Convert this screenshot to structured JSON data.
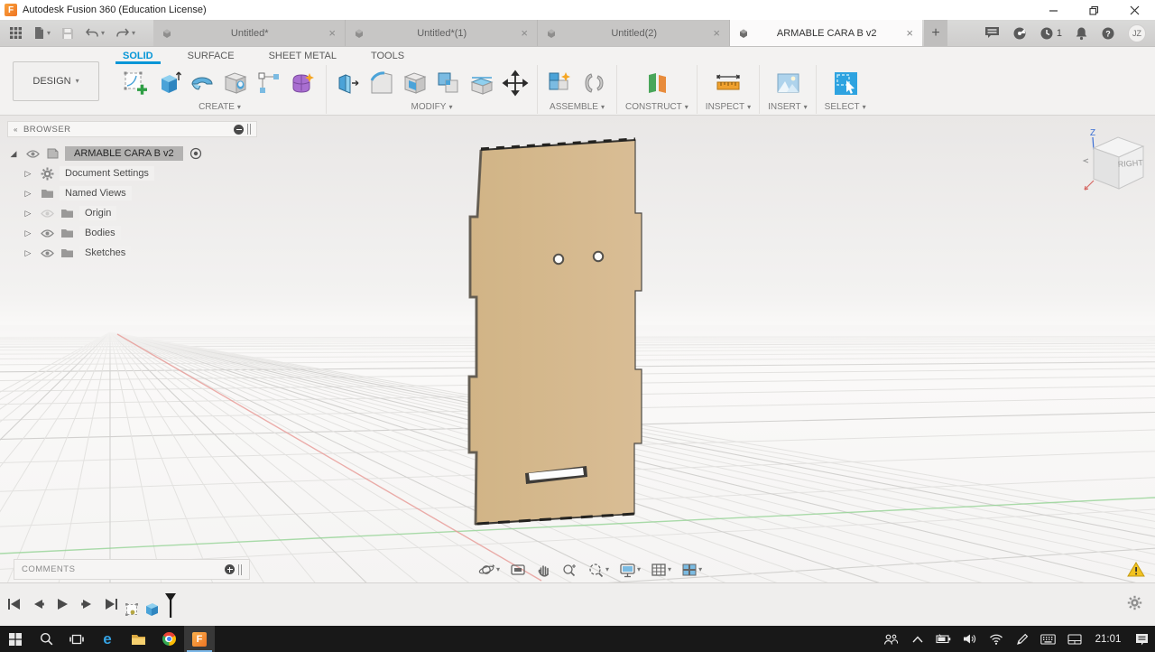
{
  "window": {
    "title": "Autodesk Fusion 360 (Education License)",
    "logo_letter": "F"
  },
  "glyphs": {
    "caret": "▾",
    "close": "×",
    "add": "+",
    "collapse": "«",
    "expand_arrow": "▷",
    "root_arrow": "◢",
    "help": "?"
  },
  "tabs": {
    "items": [
      {
        "label": "Untitled*"
      },
      {
        "label": "Untitled*(1)"
      },
      {
        "label": "Untitled(2)"
      },
      {
        "label": "ARMABLE CARA B v2"
      }
    ]
  },
  "appbar": {
    "job_count": "1",
    "avatar_initials": "JZ"
  },
  "ribbon": {
    "design_label": "DESIGN",
    "tabs": [
      {
        "label": "SOLID"
      },
      {
        "label": "SURFACE"
      },
      {
        "label": "SHEET METAL"
      },
      {
        "label": "TOOLS"
      }
    ],
    "groups": [
      {
        "label": "CREATE"
      },
      {
        "label": "MODIFY"
      },
      {
        "label": "ASSEMBLE"
      },
      {
        "label": "CONSTRUCT"
      },
      {
        "label": "INSPECT"
      },
      {
        "label": "INSERT"
      },
      {
        "label": "SELECT"
      }
    ]
  },
  "browser": {
    "title": "BROWSER",
    "root_label": "ARMABLE CARA B v2",
    "items": [
      {
        "label": "Document Settings",
        "icon": "gear-icon"
      },
      {
        "label": "Named Views",
        "icon": "folder-icon"
      },
      {
        "label": "Origin",
        "icon": "folder-icon",
        "hidden": true
      },
      {
        "label": "Bodies",
        "icon": "folder-icon"
      },
      {
        "label": "Sketches",
        "icon": "folder-icon"
      }
    ]
  },
  "comments": {
    "label": "COMMENTS"
  },
  "viewcube": {
    "face_label": "RIGHT",
    "z_label": "Z"
  },
  "taskbar": {
    "time": "21:01"
  },
  "colors": {
    "accent_blue": "#0696d7",
    "board_tan": "#d5b98f",
    "axis_green": "#8fd18f",
    "axis_red": "#e89a96",
    "taskbar_underline": "#7cb8e8",
    "warning_yellow": "#f2c321"
  }
}
